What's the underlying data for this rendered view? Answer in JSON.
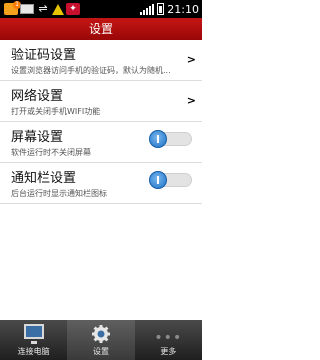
{
  "status_bar": {
    "time": "21:10",
    "badge": "1",
    "icons": [
      "shopping-bag-icon",
      "mail-icon",
      "usb-icon",
      "warning-icon",
      "app-icon",
      "signal-icon",
      "battery-icon"
    ]
  },
  "header": {
    "title": "设置"
  },
  "settings": [
    {
      "title": "验证码设置",
      "subtitle": "设置浏览器访问手机的验证码，默认为随机...",
      "control": "chevron"
    },
    {
      "title": "网络设置",
      "subtitle": "打开或关闭手机WIFI功能",
      "control": "chevron"
    },
    {
      "title": "屏幕设置",
      "subtitle": "软件运行时不关闭屏幕",
      "control": "toggle",
      "on": true
    },
    {
      "title": "通知栏设置",
      "subtitle": "后台运行时显示通知栏图标",
      "control": "toggle",
      "on": true
    }
  ],
  "chevron_glyph": ">",
  "bottom_nav": [
    {
      "label": "连接电脑",
      "icon": "computer-icon",
      "active": false
    },
    {
      "label": "设置",
      "icon": "gear-icon",
      "active": true
    },
    {
      "label": "更多",
      "icon": "more-dots-icon",
      "active": false
    }
  ],
  "colors": {
    "title_bar": "#b30f0f",
    "toggle_knob": "#1a6fc4",
    "nav_bg": "#2e2e2e"
  }
}
